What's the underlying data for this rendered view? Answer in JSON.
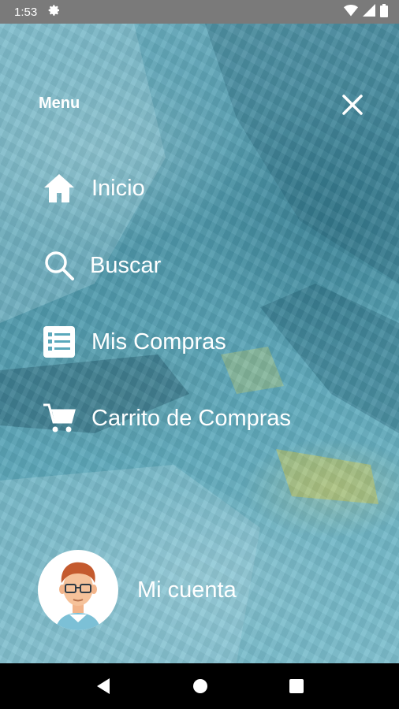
{
  "status_bar": {
    "time": "1:53",
    "icons": [
      "settings-icon",
      "wifi-icon",
      "signal-icon",
      "battery-icon"
    ]
  },
  "menu": {
    "title": "Menu",
    "close_icon": "close-icon",
    "items": [
      {
        "label": "Inicio",
        "icon": "home-icon"
      },
      {
        "label": "Buscar",
        "icon": "search-icon"
      },
      {
        "label": "Mis Compras",
        "icon": "list-icon"
      },
      {
        "label": "Carrito de Compras",
        "icon": "cart-icon"
      }
    ]
  },
  "account": {
    "label": "Mi cuenta",
    "avatar_icon": "user-avatar-icon"
  },
  "nav_bar": {
    "buttons": [
      "back-icon",
      "home-circle-icon",
      "recents-icon"
    ]
  },
  "colors": {
    "overlay": "#5aa8bb",
    "status_bar": "#7a7a7a",
    "text": "#ffffff"
  }
}
